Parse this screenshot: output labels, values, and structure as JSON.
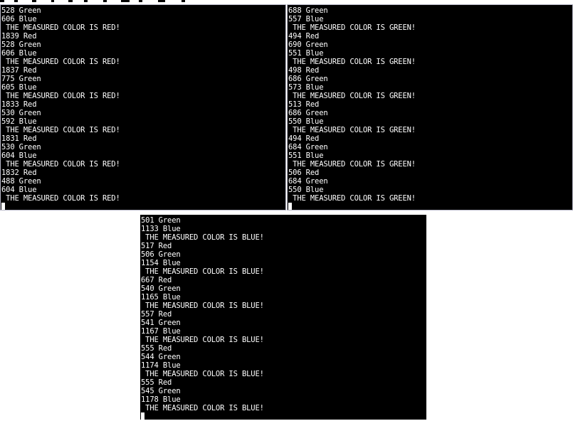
{
  "terminals": {
    "red": {
      "lines": [
        "528 Green",
        "606 Blue",
        " THE MEASURED COLOR IS RED!",
        "1839 Red",
        "528 Green",
        "606 Blue",
        " THE MEASURED COLOR IS RED!",
        "1837 Red",
        "775 Green",
        "605 Blue",
        " THE MEASURED COLOR IS RED!",
        "1833 Red",
        "530 Green",
        "592 Blue",
        " THE MEASURED COLOR IS RED!",
        "1831 Red",
        "530 Green",
        "604 Blue",
        " THE MEASURED COLOR IS RED!",
        "1832 Red",
        "488 Green",
        "604 Blue",
        " THE MEASURED COLOR IS RED!"
      ]
    },
    "green": {
      "lines": [
        "688 Green",
        "557 Blue",
        " THE MEASURED COLOR IS GREEN!",
        "494 Red",
        "690 Green",
        "551 Blue",
        " THE MEASURED COLOR IS GREEN!",
        "498 Red",
        "686 Green",
        "573 Blue",
        " THE MEASURED COLOR IS GREEN!",
        "513 Red",
        "686 Green",
        "550 Blue",
        " THE MEASURED COLOR IS GREEN!",
        "494 Red",
        "684 Green",
        "551 Blue",
        " THE MEASURED COLOR IS GREEN!",
        "506 Red",
        "684 Green",
        "550 Blue",
        " THE MEASURED COLOR IS GREEN!"
      ]
    },
    "blue": {
      "lines": [
        "501 Green",
        "1133 Blue",
        " THE MEASURED COLOR IS BLUE!",
        "517 Red",
        "506 Green",
        "1154 Blue",
        " THE MEASURED COLOR IS BLUE!",
        "667 Red",
        "540 Green",
        "1165 Blue",
        " THE MEASURED COLOR IS BLUE!",
        "557 Red",
        "541 Green",
        "1167 Blue",
        " THE MEASURED COLOR IS BLUE!",
        "555 Red",
        "544 Green",
        "1174 Blue",
        " THE MEASURED COLOR IS BLUE!",
        "555 Red",
        "545 Green",
        "1178 Blue",
        " THE MEASURED COLOR IS BLUE!"
      ]
    }
  },
  "colors": {
    "terminal_bg": "#000000",
    "terminal_fg": "#ffffff",
    "window_border": "#b9b9c9"
  }
}
